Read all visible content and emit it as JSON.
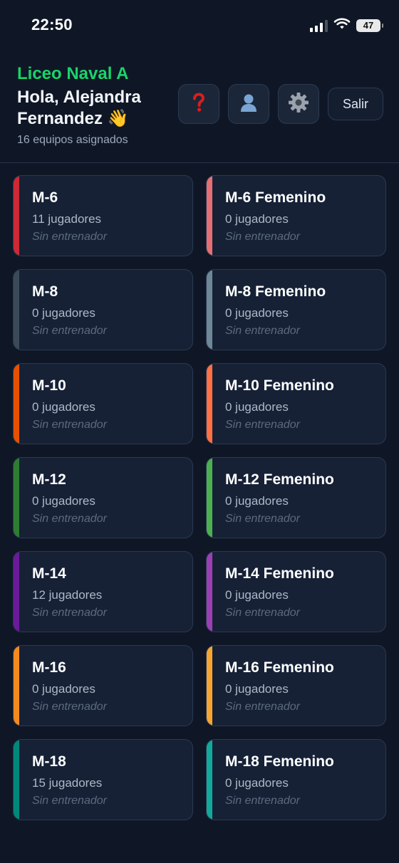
{
  "status_bar": {
    "time": "22:50",
    "battery": "47"
  },
  "header": {
    "school": "Liceo Naval A",
    "greeting": "Hola, Alejandra Fernandez 👋",
    "teams_count": "16 equipos asignados",
    "logout_label": "Salir",
    "icons": [
      "help-icon",
      "profile-icon",
      "settings-icon"
    ]
  },
  "teams": [
    {
      "name": "M-6",
      "players": "11 jugadores",
      "coach": "Sin entrenador",
      "color": "#cc2a36"
    },
    {
      "name": "M-6 Femenino",
      "players": "0 jugadores",
      "coach": "Sin entrenador",
      "color": "#e56f73"
    },
    {
      "name": "M-8",
      "players": "0 jugadores",
      "coach": "Sin entrenador",
      "color": "#3b4a58"
    },
    {
      "name": "M-8 Femenino",
      "players": "0 jugadores",
      "coach": "Sin entrenador",
      "color": "#6f8797"
    },
    {
      "name": "M-10",
      "players": "0 jugadores",
      "coach": "Sin entrenador",
      "color": "#e65100"
    },
    {
      "name": "M-10 Femenino",
      "players": "0 jugadores",
      "coach": "Sin entrenador",
      "color": "#ff7043"
    },
    {
      "name": "M-12",
      "players": "0 jugadores",
      "coach": "Sin entrenador",
      "color": "#2e7d32"
    },
    {
      "name": "M-12 Femenino",
      "players": "0 jugadores",
      "coach": "Sin entrenador",
      "color": "#4caf50"
    },
    {
      "name": "M-14",
      "players": "12 jugadores",
      "coach": "Sin entrenador",
      "color": "#6a1b9a"
    },
    {
      "name": "M-14 Femenino",
      "players": "0 jugadores",
      "coach": "Sin entrenador",
      "color": "#9c3fb5"
    },
    {
      "name": "M-16",
      "players": "0 jugadores",
      "coach": "Sin entrenador",
      "color": "#f38a1f"
    },
    {
      "name": "M-16 Femenino",
      "players": "0 jugadores",
      "coach": "Sin entrenador",
      "color": "#f6a531"
    },
    {
      "name": "M-18",
      "players": "15 jugadores",
      "coach": "Sin entrenador",
      "color": "#00897b"
    },
    {
      "name": "M-18 Femenino",
      "players": "0 jugadores",
      "coach": "Sin entrenador",
      "color": "#11a99a"
    }
  ]
}
